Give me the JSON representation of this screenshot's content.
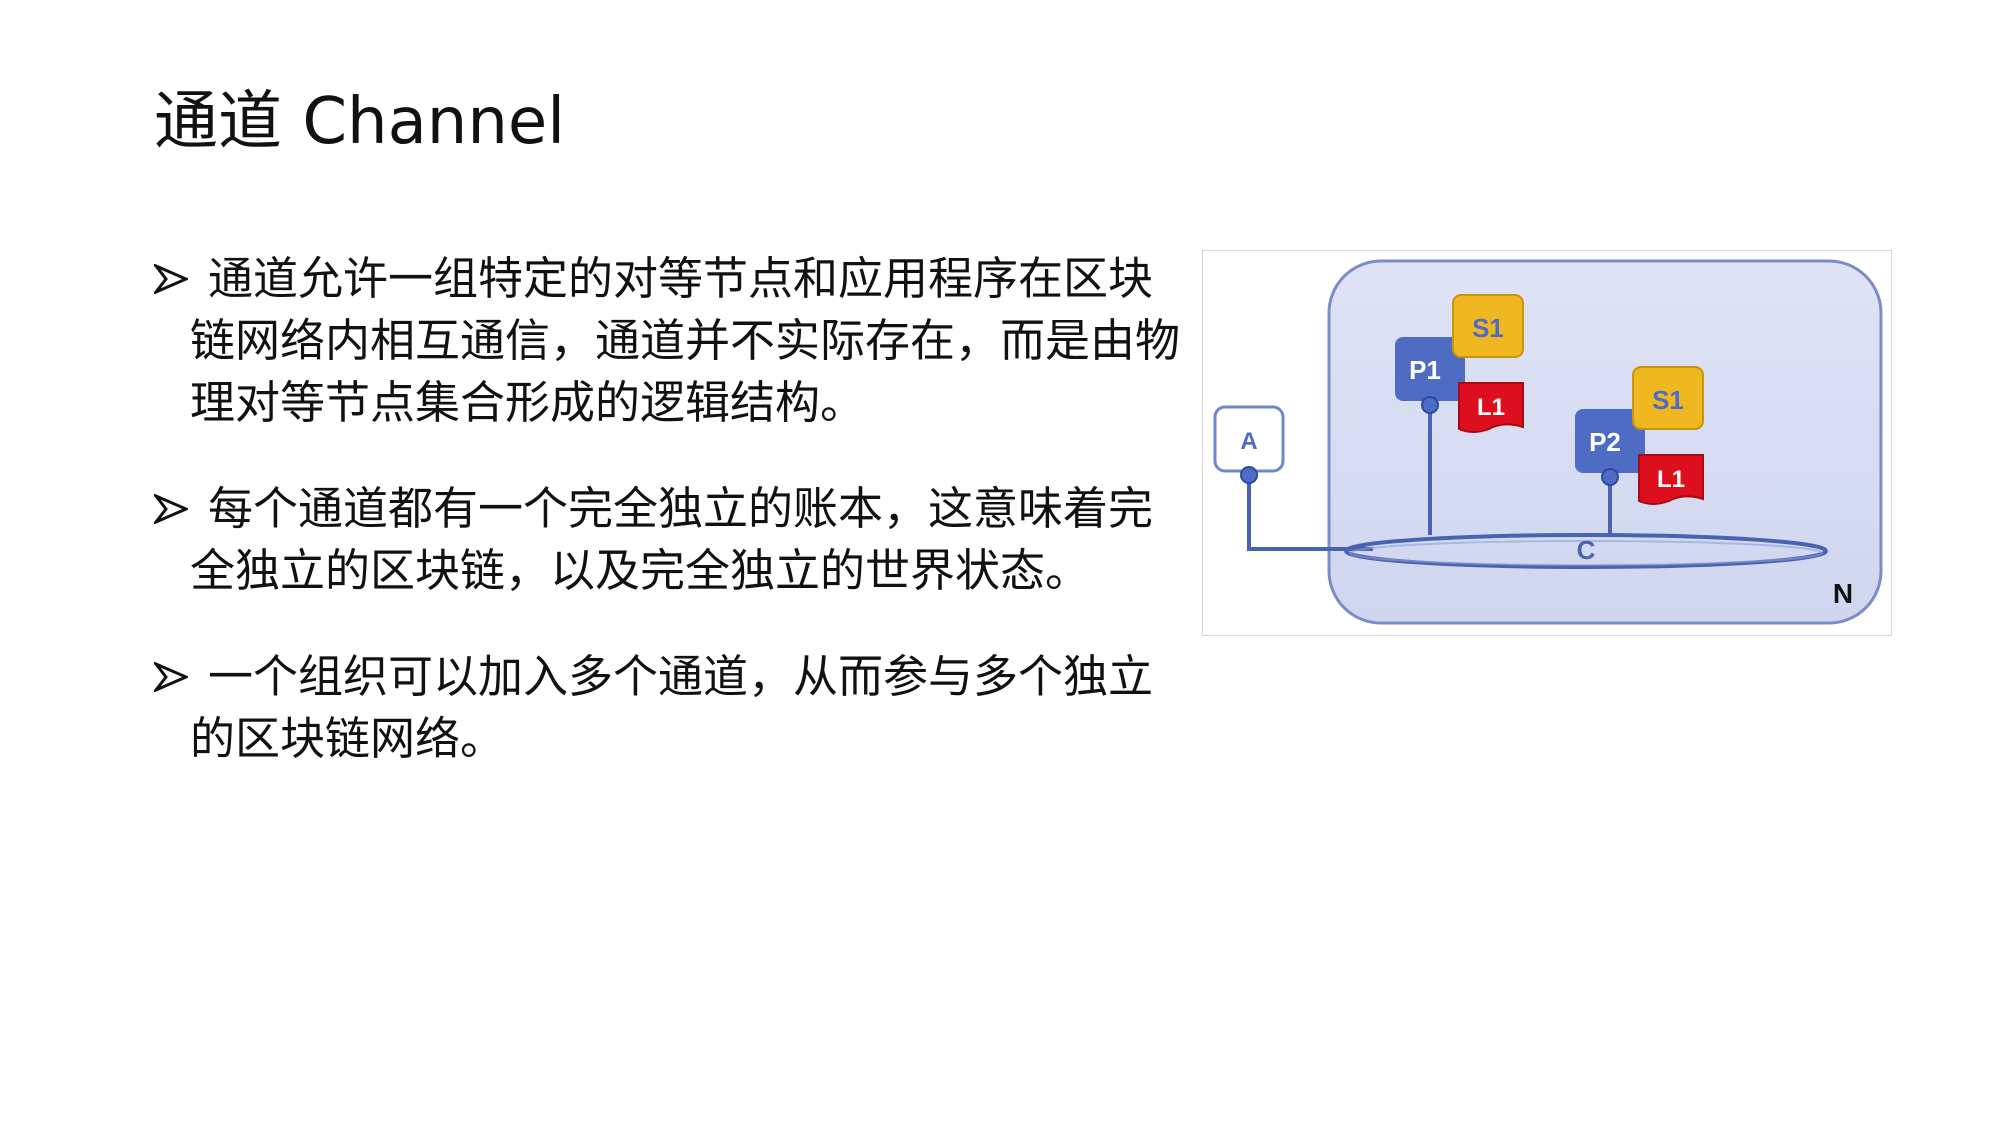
{
  "slide": {
    "title": "通道 Channel",
    "bullets": [
      {
        "text": "通道允许一组特定的对等节点和应用程序在区块链网络内相互通信，通道并不实际存在，而是由物理对等节点集合形成的逻辑结构。"
      },
      {
        "text": "每个通道都有一个完全独立的账本，这意味着完全独立的区块链，以及完全独立的世界状态。"
      },
      {
        "text": "一个组织可以加入多个通道，从而参与多个独立的区块链网络。"
      }
    ]
  },
  "diagram": {
    "application_label": "A",
    "peer1_label": "P1",
    "peer2_label": "P2",
    "smart_contract1_label": "S1",
    "smart_contract2_label": "S1",
    "ledger1_label": "L1",
    "ledger2_label": "L1",
    "channel_label": "C",
    "network_label": "N",
    "colors": {
      "network_fill": "#d9def2",
      "network_stroke": "#7b8cc8",
      "peer": "#4f6cc4",
      "contract": "#f0b820",
      "ledger": "#dd0f1e",
      "line": "#4a63b0"
    }
  }
}
